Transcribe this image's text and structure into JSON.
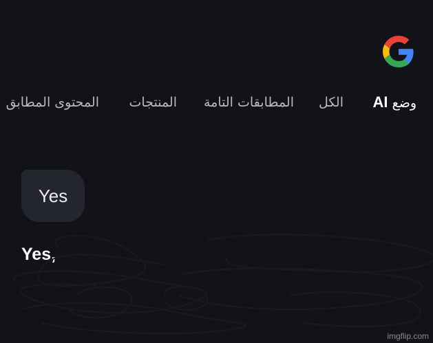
{
  "header": {
    "logo_icon": "google-g-icon",
    "logo_colors": [
      "#4285F4",
      "#EA4335",
      "#FBBC05",
      "#34A853"
    ]
  },
  "tabs": {
    "ai_mode_prefix": "وضع",
    "ai_mode_word": "AI",
    "all": "الكل",
    "exact_matches": "المطابقات التامة",
    "products": "المنتجات",
    "matching_content": "المحتوى المطابق"
  },
  "conversation": {
    "user_message": "Yes",
    "ai_response_start": "Yes,"
  },
  "watermark": "imgflip.com"
}
